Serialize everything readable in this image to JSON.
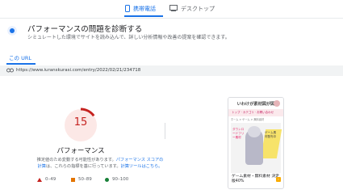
{
  "device_tabs": [
    {
      "label": "携帯電話",
      "icon": "smartphone-icon",
      "active": true
    },
    {
      "label": "デスクトップ",
      "icon": "desktop-icon",
      "active": false
    }
  ],
  "header": {
    "title": "パフォーマンスの問題を診断する",
    "subtitle": "シミュレートした環境でサイトを読み込んで、詳しい分析情報や改善の提案を確認できます。"
  },
  "url_section": {
    "tab_label": "この URL",
    "url": "https://www.iuranskurasi.com/entry/2022/02/21/234718"
  },
  "score": {
    "value": "15",
    "fraction": 0.15,
    "label": "パフォーマンス",
    "color": "#c5221f",
    "description_prefix": "推定値のため変動する可能性があります。",
    "description_link1": "パフォーマンス スコアの計算",
    "description_middle": "は、これらの指標を基に行っています。",
    "description_link2": "計算ツールはこちら。"
  },
  "legend": [
    {
      "range": "0–49",
      "shape": "triangle",
      "color": "#c5221f"
    },
    {
      "range": "50–89",
      "shape": "square",
      "color": "#e37400"
    },
    {
      "range": "90–100",
      "shape": "circle",
      "color": "#188038"
    }
  ],
  "preview": {
    "site_logo": "いわけが素材図が図",
    "nav": "トップ · カテゴリ · お問い合わせ",
    "breadcrumb": "ホーム > ゲーム > 無料素材",
    "hero_left": "ダウンロードフリー素材",
    "hero_right": "ゲーム素材配布中",
    "post_title": "ゲーム素材・無料素材 決定版40%"
  }
}
